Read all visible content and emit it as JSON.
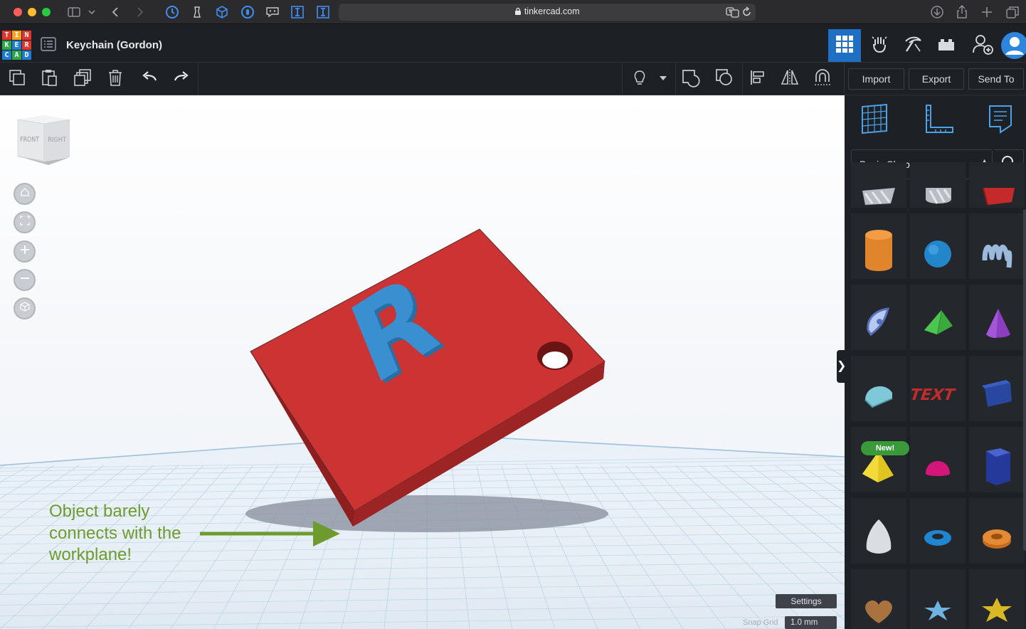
{
  "browser": {
    "url": "tinkercad.com"
  },
  "header": {
    "logo_letters": [
      "T",
      "I",
      "N",
      "K",
      "E",
      "R",
      "C",
      "A",
      "D"
    ],
    "design_title": "Keychain (Gordon)"
  },
  "toolbar": {
    "import_label": "Import",
    "export_label": "Export",
    "send_to_label": "Send To"
  },
  "workplane": {
    "view_cube_front": "FRONT",
    "view_cube_right": "RIGHT",
    "letter_on_keychain": "R",
    "annotation_lines": [
      "Object barely",
      "connects with the",
      "workplane!"
    ],
    "settings_label": "Settings",
    "snap_grid_label": "Snap Grid",
    "snap_grid_value": "1.0 mm"
  },
  "panel": {
    "shape_category": "Basic Shapes",
    "new_badge": "New!",
    "text_shape_label": "TEXT",
    "shapes": [
      "box-striped",
      "cylinder-striped",
      "box-red",
      "cylinder-orange",
      "sphere-blue",
      "scribble",
      "shape-generator",
      "roof-green",
      "cone-purple",
      "round-roof",
      "text",
      "box-blue",
      "pyramid-yellow",
      "half-sphere-pink",
      "polygon-blue",
      "paraboloid",
      "torus-blue",
      "tube-orange",
      "heart",
      "star-blue",
      "star-yellow"
    ]
  },
  "colors": {
    "accent_blue": "#1f6fc5",
    "keychain_red": "#cc3333",
    "letter_blue": "#3a8fd0",
    "annotation_green": "#6e9b2e"
  }
}
